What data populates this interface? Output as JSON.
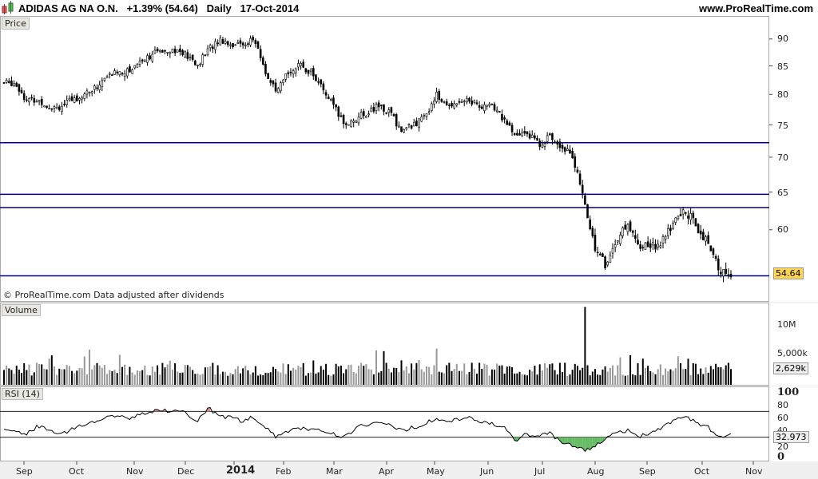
{
  "header": {
    "title": "ADIDAS AG NA O.N.",
    "change": "+1.39% (54.64)",
    "period": "Daily",
    "date": "17-Oct-2014",
    "site": "www.ProRealTime.com"
  },
  "price_panel": {
    "label": "Price",
    "copyright": "© ProRealTime.com  Data adjusted after dividends",
    "ticks": [
      "90",
      "85",
      "80",
      "75",
      "70",
      "65",
      "60"
    ],
    "current": "54.64",
    "hlines": [
      72.2,
      64.7,
      62.9,
      54.4
    ],
    "line_color": "#000080",
    "weekly_closes": [
      82,
      82,
      79,
      79,
      78,
      78,
      79,
      80,
      81,
      83,
      84,
      84,
      86,
      87,
      88,
      88,
      87,
      85,
      88,
      90,
      89,
      89,
      90,
      84,
      80,
      84,
      85,
      84,
      81,
      78,
      75,
      76,
      77,
      78,
      77,
      74,
      75,
      76,
      80,
      78,
      79,
      79,
      78,
      78,
      76,
      73,
      74,
      72,
      73,
      72,
      70.5,
      64,
      58,
      55.5,
      59,
      60.5,
      58,
      58,
      58.5,
      61,
      62.5,
      60.5,
      58,
      55,
      54.64
    ]
  },
  "volume_panel": {
    "label": "Volume",
    "ticks": [
      "10M",
      "5,000k"
    ],
    "current": "2,629k"
  },
  "rsi_panel": {
    "label": "RSI (14)",
    "ticks": [
      "100",
      "80",
      "60",
      "40",
      "20",
      "0"
    ],
    "current": "32.973",
    "levels": [
      70,
      30
    ],
    "weekly": [
      45,
      40,
      35,
      48,
      40,
      35,
      42,
      50,
      55,
      60,
      62,
      60,
      65,
      70,
      72,
      70,
      68,
      55,
      75,
      62,
      60,
      55,
      62,
      45,
      30,
      40,
      45,
      40,
      42,
      35,
      30,
      45,
      50,
      52,
      48,
      40,
      45,
      50,
      60,
      55,
      58,
      60,
      55,
      52,
      45,
      25,
      35,
      30,
      38,
      22,
      18,
      10,
      15,
      30,
      38,
      40,
      32,
      38,
      45,
      55,
      62,
      52,
      45,
      28,
      33
    ]
  },
  "x_axis": [
    "Sep",
    "Oct",
    "Nov",
    "Dec",
    "2014",
    "Feb",
    "Mar",
    "Apr",
    "May",
    "Jun",
    "Jul",
    "Aug",
    "Sep",
    "Oct",
    "Nov"
  ]
}
